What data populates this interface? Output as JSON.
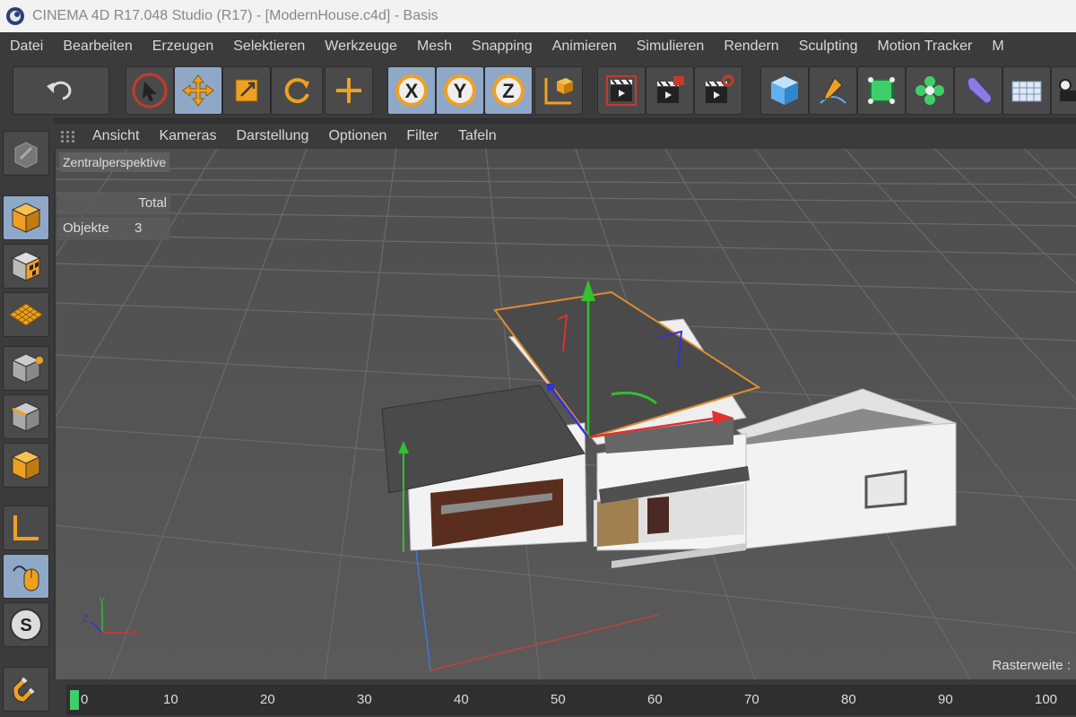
{
  "window": {
    "title": "CINEMA 4D R17.048 Studio (R17) - [ModernHouse.c4d] - Basis"
  },
  "menu": {
    "items": [
      "Datei",
      "Bearbeiten",
      "Erzeugen",
      "Selektieren",
      "Werkzeuge",
      "Mesh",
      "Snapping",
      "Animieren",
      "Simulieren",
      "Rendern",
      "Sculpting",
      "Motion Tracker",
      "M"
    ]
  },
  "viewport": {
    "menu": [
      "Ansicht",
      "Kameras",
      "Darstellung",
      "Optionen",
      "Filter",
      "Tafeln"
    ],
    "view_label": "Zentralperspektive",
    "hud": {
      "total_label": "Total",
      "objects_label": "Objekte",
      "objects_value": "3"
    },
    "axis_labels": {
      "x": "X",
      "y": "Y",
      "z": "Z"
    },
    "grid_text": "Rasterweite :"
  },
  "toolbar": {
    "axis_x": "X",
    "axis_y": "Y",
    "axis_z": "Z"
  },
  "leftbar": {
    "snap_label": "S"
  },
  "timeline": {
    "ticks": [
      "0",
      "10",
      "20",
      "30",
      "40",
      "50",
      "60",
      "70",
      "80",
      "90",
      "100"
    ]
  },
  "colors": {
    "accent_orange": "#f0a020",
    "active_blue": "#8fa8c8",
    "axis_red": "#e03030",
    "axis_green": "#30c030",
    "axis_blue": "#3030e0"
  }
}
